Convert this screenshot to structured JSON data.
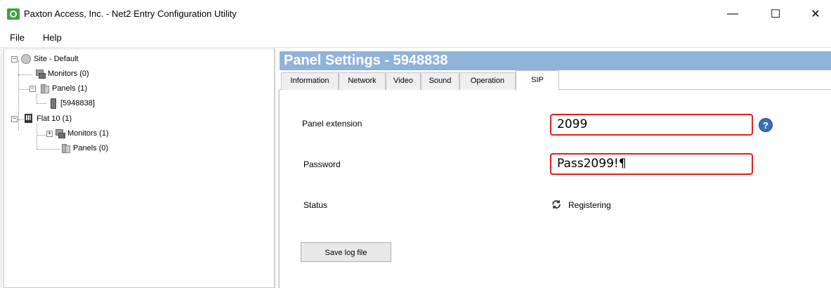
{
  "window": {
    "title": "Paxton Access, Inc. - Net2 Entry Configuration Utility",
    "minimize": "—",
    "maximize": "☐",
    "close": "✕"
  },
  "menu": {
    "file": "File",
    "help": "Help"
  },
  "tree": {
    "site": "Site - Default",
    "monitors": "Monitors (0)",
    "panels": "Panels (1)",
    "panel_device": "[5948838]",
    "flat": "Flat 10 (1)",
    "flat_monitors": "Monitors (1)",
    "flat_panels": "Panels (0)",
    "expander_minus": "−",
    "expander_plus": "+"
  },
  "settings": {
    "title": "Panel Settings - 5948838",
    "tabs": [
      "Information",
      "Network",
      "Video",
      "Sound",
      "Operation",
      "SIP"
    ],
    "active_tab": "SIP",
    "panel_extension_label": "Panel extension",
    "panel_extension_value": "2099",
    "password_label": "Password",
    "password_value": "Pass2099!¶",
    "status_label": "Status",
    "status_value": "Registering",
    "status_icon": "refresh-icon",
    "help_glyph": "?",
    "save_log_label": "Save log file"
  }
}
